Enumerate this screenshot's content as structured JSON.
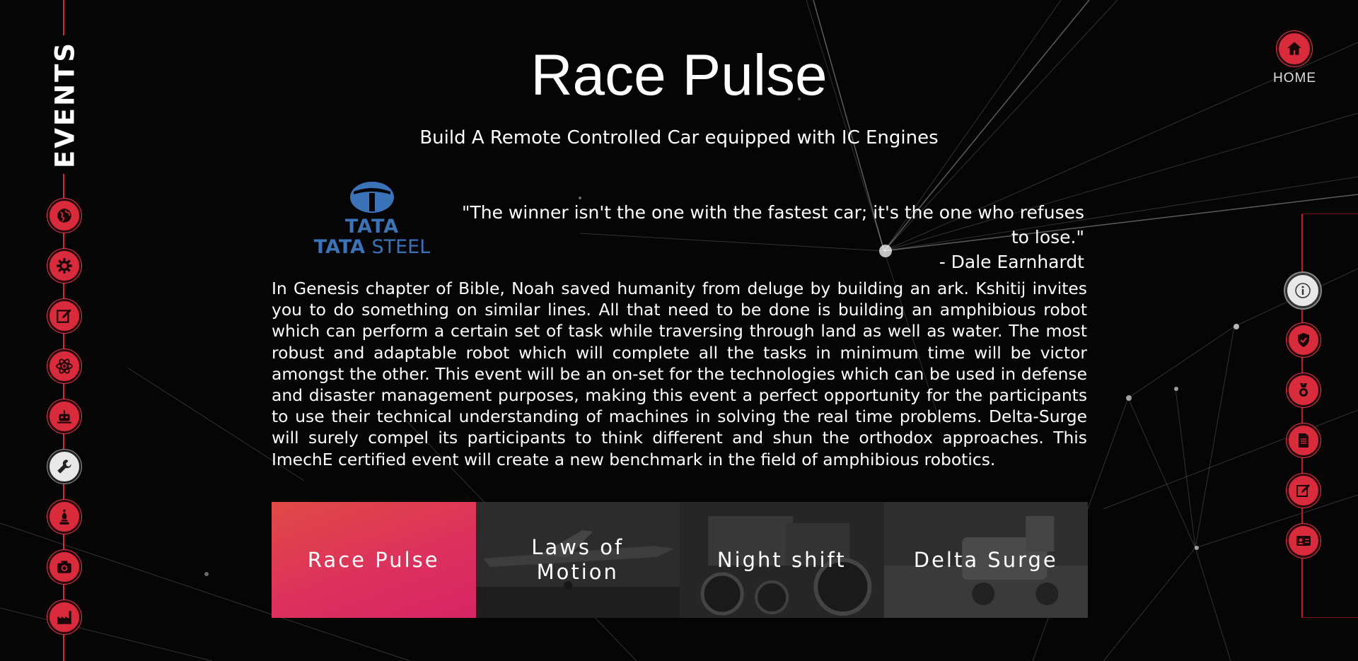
{
  "sidebar_left": {
    "section_label": "EVENTS",
    "items": [
      {
        "icon": "globe-icon"
      },
      {
        "icon": "gear-icon"
      },
      {
        "icon": "edit-icon"
      },
      {
        "icon": "atom-icon"
      },
      {
        "icon": "robot-icon"
      },
      {
        "icon": "wrench-icon",
        "active": true
      },
      {
        "icon": "chess-bishop-icon"
      },
      {
        "icon": "camera-icon"
      },
      {
        "icon": "factory-icon"
      }
    ]
  },
  "sidebar_right": {
    "home_label": "HOME",
    "items": [
      {
        "icon": "info-icon",
        "active": true
      },
      {
        "icon": "shield-check-icon"
      },
      {
        "icon": "medal-icon"
      },
      {
        "icon": "document-icon"
      },
      {
        "icon": "edit-icon"
      },
      {
        "icon": "contact-card-icon"
      }
    ]
  },
  "event": {
    "title": "Race Pulse",
    "subtitle": "Build A Remote Controlled Car equipped with IC Engines",
    "sponsor": {
      "line1": "TATA",
      "line2_bold": "TATA",
      "line2_light": "STEEL",
      "color": "#3b73b9"
    },
    "quote": {
      "text": "\"The winner isn't the one with the fastest car; it's the one who refuses to lose.\"",
      "author": "- Dale Earnhardt"
    },
    "description": "In Genesis chapter of Bible, Noah saved humanity from deluge by building an ark. Kshitij invites you to do something on similar lines. All that need to be done is building an amphibious robot which can perform a certain set of task while traversing through land as well as water. The most robust and adaptable robot which will complete all the tasks in minimum time will be victor amongst the other. This event will be an on-set for the technologies which can be used in defense and disaster management purposes, making this event a perfect opportunity for the participants to use their technical understanding of machines in solving the real time problems. Delta-Surge will surely compel its participants to think different and shun the orthodox approaches. This ImechE certified event will create a new benchmark in the field of amphibious robotics."
  },
  "event_cards": [
    {
      "label": "Race Pulse",
      "active": true
    },
    {
      "label": "Laws of Motion",
      "active": false
    },
    {
      "label": "Night shift",
      "active": false
    },
    {
      "label": "Delta Surge",
      "active": false
    }
  ],
  "colors": {
    "accent": "#d92b3c",
    "active_card_start": "#e04a45",
    "active_card_end": "#d82565",
    "background": "#050505"
  }
}
